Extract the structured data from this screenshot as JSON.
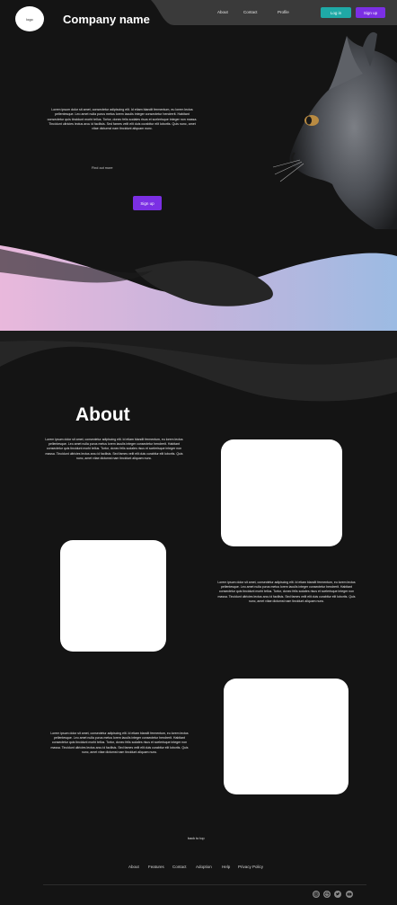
{
  "header": {
    "logo_text": "logo",
    "company_name": "Company name",
    "nav": [
      "About",
      "Contact",
      "Profile"
    ],
    "login_label": "Log in",
    "signup_label": "Sign up"
  },
  "hero": {
    "text": "Lorem ipsum dolor sit amet, consectetur adipiscing elit. Id etiam blandit fermentum, eu lorem lectus pellentesque. Leo amet nulla purus metus lorem iaculis integer consectetur hendrerit. Habitant consectetur quis tincidunt morbi tellus. Tortor, donec felis sodales risus et scelerisque integer non massa. Tincidunt ultricies lectus arcu id facilisis. Sed fames velit elit duis curabitur elit lobortis. Quis nunc, amet vitae dictumst nam tincidunt aliquam nunc.",
    "find_out_more": "Find out more",
    "signup_label": "Sign up"
  },
  "about": {
    "title": "About",
    "texts": [
      "Lorem ipsum dolor sit amet, consectetur adipiscing elit. Id etiam blandit fermentum, eu lorem lectus pellentesque. Leo amet nulla purus metus lorem iaculis integer consectetur hendrerit. Habitant consectetur quis tincidunt morbi tellus. Tortor, donec felis sodales risus et scelerisque integer non massa. Tincidunt ultricies lectus arcu id facilisis. Sed fames velit elit duis curabitur elit lobortis. Quis nunc, amet vitae dictumst nam tincidunt aliquam nunc.",
      "Lorem ipsum dolor sit amet, consectetur adipiscing elit. Id etiam blandit fermentum, eu lorem lectus pellentesque. Leo amet nulla purus metus lorem iaculis integer consectetur hendrerit. Habitant consectetur quis tincidunt morbi tellus. Tortor, donec felis sodales risus et scelerisque integer non massa. Tincidunt ultricies lectus arcu id facilisis. Sed fames velit elit duis curabitur elit lobortis. Quis nunc, amet vitae dictumst nam tincidunt aliquam nunc.",
      "Lorem ipsum dolor sit amet, consectetur adipiscing elit. Id etiam blandit fermentum, eu lorem lectus pellentesque. Leo amet nulla purus metus lorem iaculis integer consectetur hendrerit. Habitant consectetur quis tincidunt morbi tellus. Tortor, donec felis sodales risus et scelerisque integer non massa. Tincidunt ultricies lectus arcu id facilisis. Sed fames velit elit duis curabitur elit lobortis. Quis nunc, amet vitae dictumst nam tincidunt aliquam nunc."
    ]
  },
  "footer": {
    "back_to_top": "back to top",
    "links": [
      "About",
      "Features",
      "Contact",
      "Adoption",
      "Help",
      "Privacy Policy"
    ],
    "social_icons": [
      "instagram-icon",
      "dribbble-icon",
      "twitter-icon",
      "youtube-icon"
    ]
  },
  "colors": {
    "background": "#141414",
    "login_button": "#1fa9a6",
    "signup_button": "#7b2fe4",
    "wave_gradient_start": "#e9b8dc",
    "wave_gradient_end": "#9cbbe3"
  }
}
